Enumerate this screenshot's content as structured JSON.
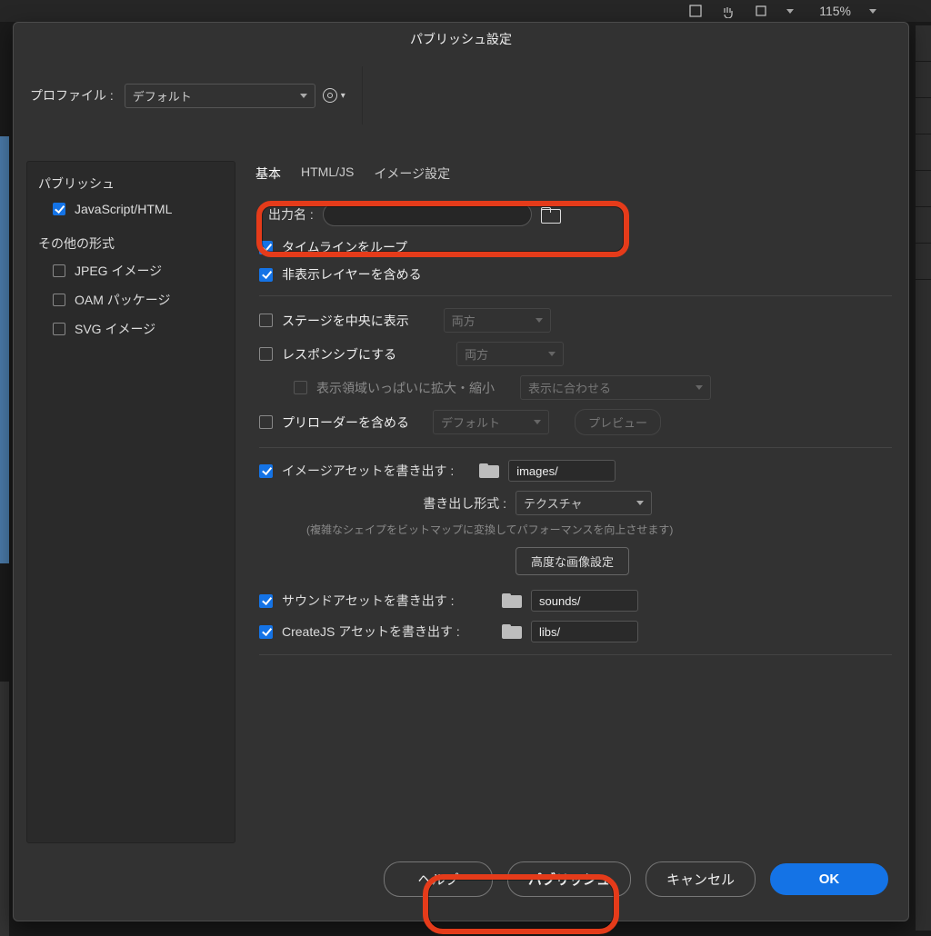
{
  "bg": {
    "zoom": "115%"
  },
  "dialog": {
    "title": "パブリッシュ設定",
    "profile_label": "プロファイル :",
    "profile_value": "デフォルト"
  },
  "sidebar": {
    "publish_header": "パブリッシュ",
    "items": [
      {
        "label": "JavaScript/HTML",
        "checked": true
      }
    ],
    "other_header": "その他の形式",
    "other_items": [
      {
        "label": "JPEG イメージ",
        "checked": false
      },
      {
        "label": "OAM パッケージ",
        "checked": false
      },
      {
        "label": "SVG イメージ",
        "checked": false
      }
    ]
  },
  "tabs": {
    "basic": "基本",
    "htmljs": "HTML/JS",
    "image": "イメージ設定"
  },
  "fields": {
    "output_name_label": "出力名 :",
    "output_name_value": "",
    "loop_timeline": "タイムラインをループ",
    "include_hidden": "非表示レイヤーを含める",
    "center_stage": "ステージを中央に表示",
    "center_stage_opt": "両方",
    "responsive": "レスポンシブにする",
    "responsive_opt": "両方",
    "fill_viewport": "表示領域いっぱいに拡大・縮小",
    "fill_viewport_opt": "表示に合わせる",
    "preloader": "プリローダーを含める",
    "preloader_opt": "デフォルト",
    "preview_btn": "プレビュー",
    "export_images": "イメージアセットを書き出す :",
    "images_path": "images/",
    "export_format_label": "書き出し形式 :",
    "export_format_value": "テクスチャ",
    "export_hint": "(複雑なシェイプをビットマップに変換してパフォーマンスを向上させます)",
    "advanced_image_btn": "高度な画像設定",
    "export_sounds": "サウンドアセットを書き出す :",
    "sounds_path": "sounds/",
    "export_createjs": "CreateJS アセットを書き出す :",
    "libs_path": "libs/"
  },
  "footer": {
    "help": "ヘルプ",
    "publish": "パブリッシュ",
    "cancel": "キャンセル",
    "ok": "OK"
  }
}
